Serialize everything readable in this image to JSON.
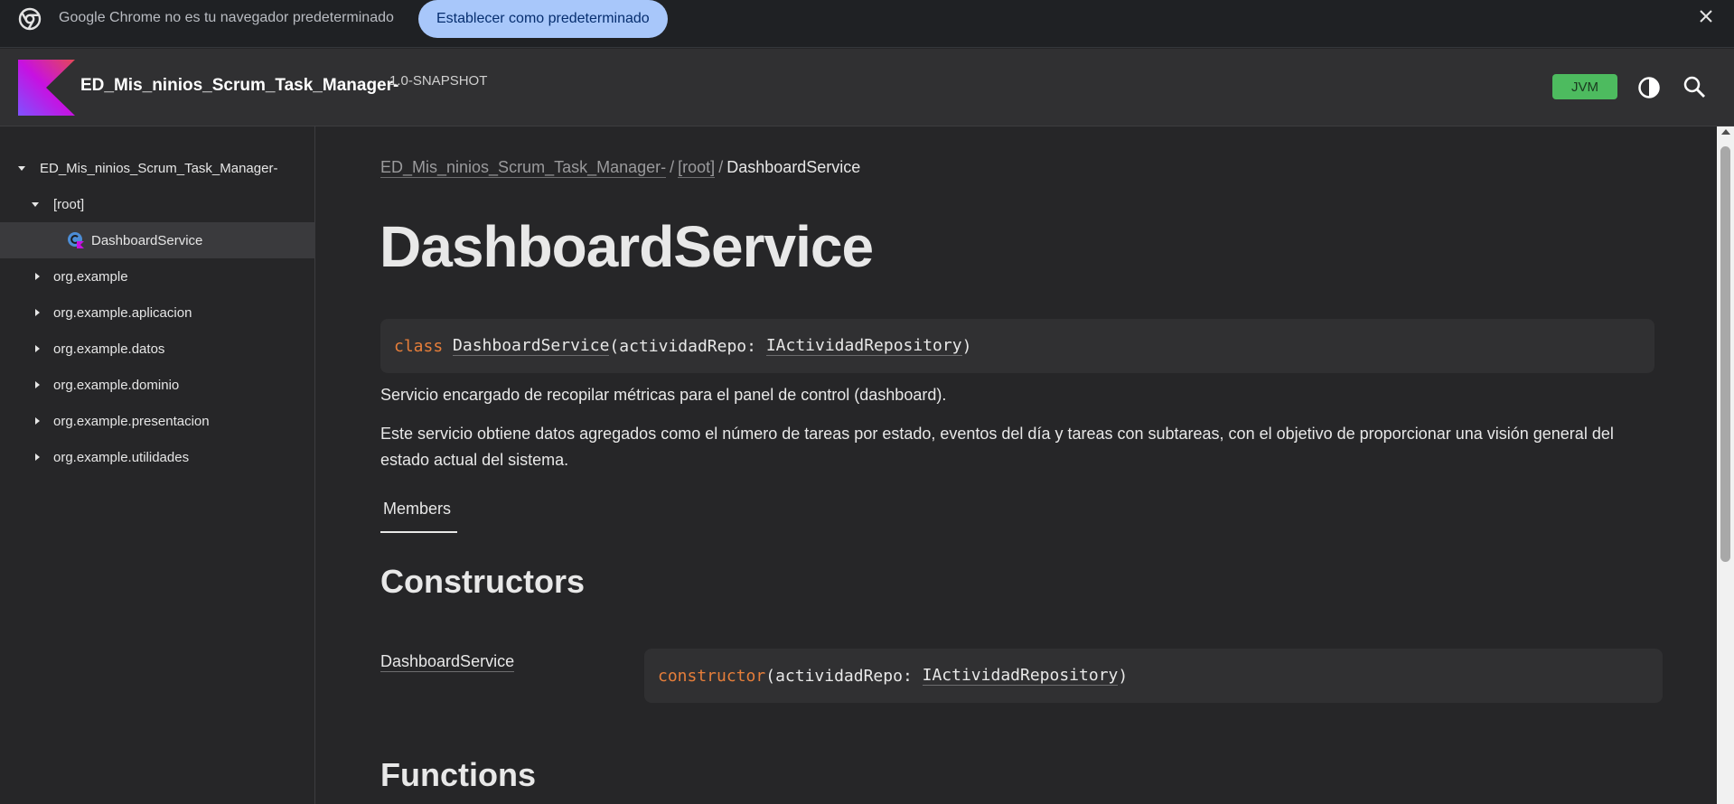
{
  "infobar": {
    "message": "Google Chrome no es tu navegador predeterminado",
    "button_label": "Establecer como predeterminado"
  },
  "header": {
    "library_name": "ED_Mis_ninios_Scrum_Task_Manager-",
    "version": "1.0-SNAPSHOT",
    "platform_badge": "JVM"
  },
  "sidebar": {
    "items": [
      {
        "label": "ED_Mis_ninios_Scrum_Task_Manager-",
        "expanded": true
      },
      {
        "label": "[root]",
        "expanded": true
      },
      {
        "label": "DashboardService",
        "selected": true
      },
      {
        "label": "org.example",
        "expanded": false
      },
      {
        "label": "org.example.aplicacion",
        "expanded": false
      },
      {
        "label": "org.example.datos",
        "expanded": false
      },
      {
        "label": "org.example.dominio",
        "expanded": false
      },
      {
        "label": "org.example.presentacion",
        "expanded": false
      },
      {
        "label": "org.example.utilidades",
        "expanded": false
      }
    ]
  },
  "main": {
    "breadcrumb": [
      "ED_Mis_ninios_Scrum_Task_Manager-",
      "[root]",
      "DashboardService"
    ],
    "breadcrumb_separator": "/",
    "title": "DashboardService",
    "signature": {
      "keyword": "class",
      "name": "DashboardService",
      "open": "(",
      "param": "actividadRepo: ",
      "param_type": "IActividadRepository",
      "close": ")"
    },
    "description_short": "Servicio encargado de recopilar métricas para el panel de control (dashboard).",
    "description_long": "Este servicio obtiene datos agregados como el número de tareas por estado, eventos del día y tareas con subtareas, con el objetivo de proporcionar una visión general del estado actual del sistema.",
    "tab_label": "Members",
    "constructors_heading": "Constructors",
    "constructor": {
      "name": "DashboardService",
      "keyword": "constructor",
      "open": "(",
      "param": "actividadRepo: ",
      "param_type": "IActividadRepository",
      "close": ")"
    },
    "functions_heading": "Functions"
  },
  "colors": {
    "keyword": "#e67e3a",
    "jvm_badge": "#4dbb5f",
    "infobar_button": "#a8c7fa"
  }
}
